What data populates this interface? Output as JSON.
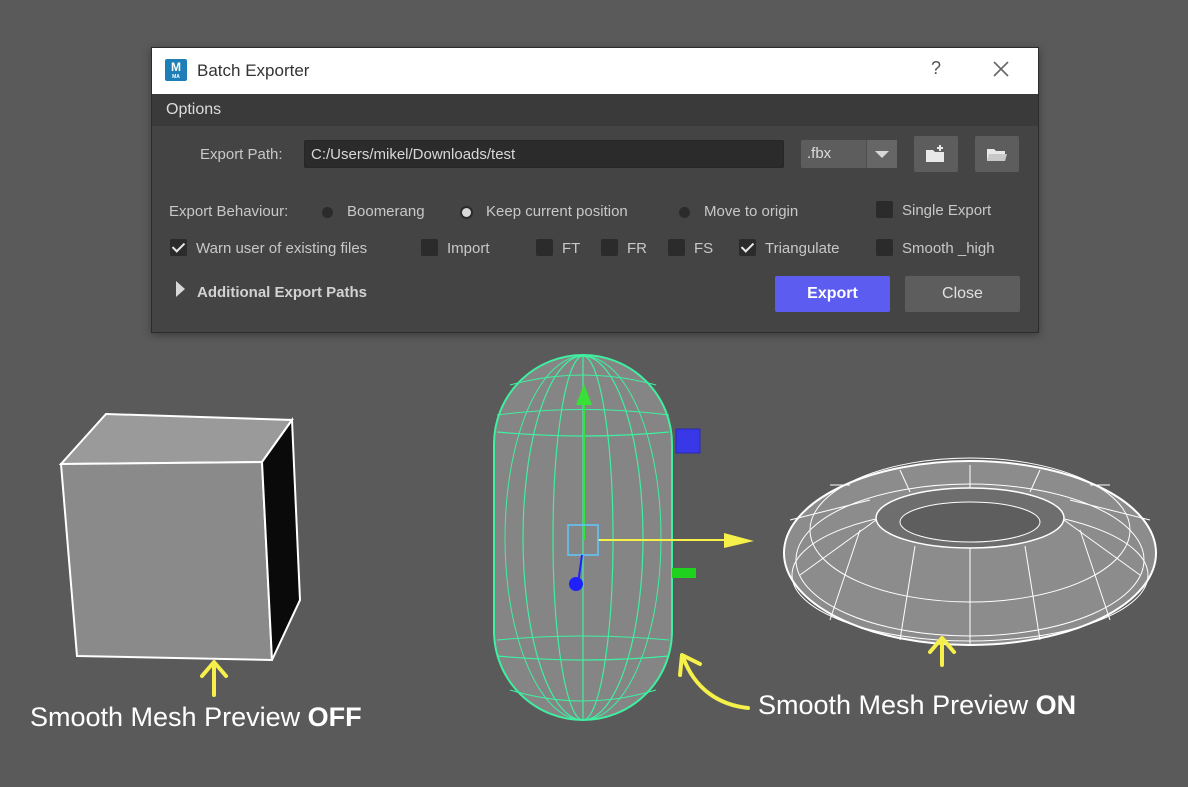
{
  "window": {
    "title": "Batch Exporter",
    "help_label": "?",
    "app_icon_letter": "M",
    "app_icon_sub": "MA"
  },
  "menu": {
    "options": "Options"
  },
  "export_path": {
    "label": "Export Path:",
    "value": "C:/Users/mikel/Downloads/test",
    "format_selected": ".fbx"
  },
  "behaviour": {
    "label": "Export Behaviour:",
    "options": [
      {
        "label": "Boomerang",
        "selected": false
      },
      {
        "label": "Keep current position",
        "selected": true
      },
      {
        "label": "Move to origin",
        "selected": false
      }
    ]
  },
  "checkboxes": [
    {
      "label": "Single Export",
      "checked": false
    },
    {
      "label": "Warn user of existing files",
      "checked": true
    },
    {
      "label": "Import",
      "checked": false
    },
    {
      "label": "FT",
      "checked": false
    },
    {
      "label": "FR",
      "checked": false
    },
    {
      "label": "FS",
      "checked": false
    },
    {
      "label": "Triangulate",
      "checked": true
    },
    {
      "label": "Smooth _high",
      "checked": false
    }
  ],
  "additional_paths_label": "Additional Export Paths",
  "buttons": {
    "export": "Export",
    "close": "Close"
  },
  "captions": {
    "left_prefix": "Smooth Mesh Preview ",
    "left_emph": "OFF",
    "right_prefix": "Smooth Mesh Preview ",
    "right_emph": "ON"
  },
  "colors": {
    "viewport_bg": "#5a5a5a",
    "accent": "#5c5cf0",
    "selection_wire": "#3ef0a0",
    "annotation": "#f5f04a"
  }
}
